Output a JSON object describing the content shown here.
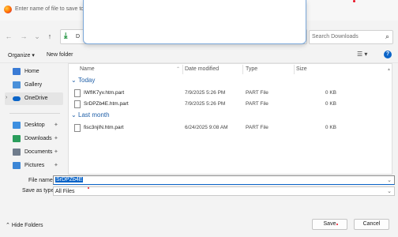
{
  "window": {
    "title": "Enter name of file to save to…",
    "app_icon": "firefox-icon"
  },
  "nav": {
    "back_icon": "←",
    "forward_icon": "→",
    "recent_icon": "⌄",
    "up_icon": "↑",
    "crumb": "D",
    "search_placeholder": "Search Downloads"
  },
  "toolbar": {
    "organize_label": "Organize ▾",
    "new_folder_label": "New folder",
    "view_label": "☰ ▾",
    "help_label": "?"
  },
  "sidebar": {
    "items": [
      {
        "label": "Home",
        "icon": "home-icon"
      },
      {
        "label": "Gallery",
        "icon": "gallery-icon"
      },
      {
        "label": "OneDrive",
        "icon": "onedrive-icon"
      },
      {
        "label": "Desktop",
        "icon": "desktop-icon"
      },
      {
        "label": "Downloads",
        "icon": "downloads-icon"
      },
      {
        "label": "Documents",
        "icon": "documents-icon"
      },
      {
        "label": "Pictures",
        "icon": "pictures-icon"
      }
    ]
  },
  "columns": {
    "name": "Name",
    "date": "Date modified",
    "type": "Type",
    "size": "Size"
  },
  "groups": [
    {
      "label": "Today",
      "files": [
        {
          "name": "IWfIK7yv.htm.part",
          "date": "7/9/2025 5:26 PM",
          "type": "PART File",
          "size": "0 KB"
        },
        {
          "name": "SrDPZb4E.htm.part",
          "date": "7/9/2025 5:26 PM",
          "type": "PART File",
          "size": "0 KB"
        }
      ]
    },
    {
      "label": "Last month",
      "files": [
        {
          "name": "fisc3njIN.htm.part",
          "date": "6/24/2025 9:08 AM",
          "type": "PART File",
          "size": "0 KB"
        }
      ]
    }
  ],
  "form": {
    "file_name_label": "File name:",
    "file_name_value": "SrDPZb4E",
    "save_type_label": "Save as type:",
    "save_type_value": "All Files"
  },
  "buttons": {
    "save": "Save",
    "cancel": "Cancel",
    "hide_folders": "Hide Folders"
  },
  "colors": {
    "accent": "#0a64c8",
    "group_text": "#1f5fa8",
    "marker": "#e81123"
  }
}
